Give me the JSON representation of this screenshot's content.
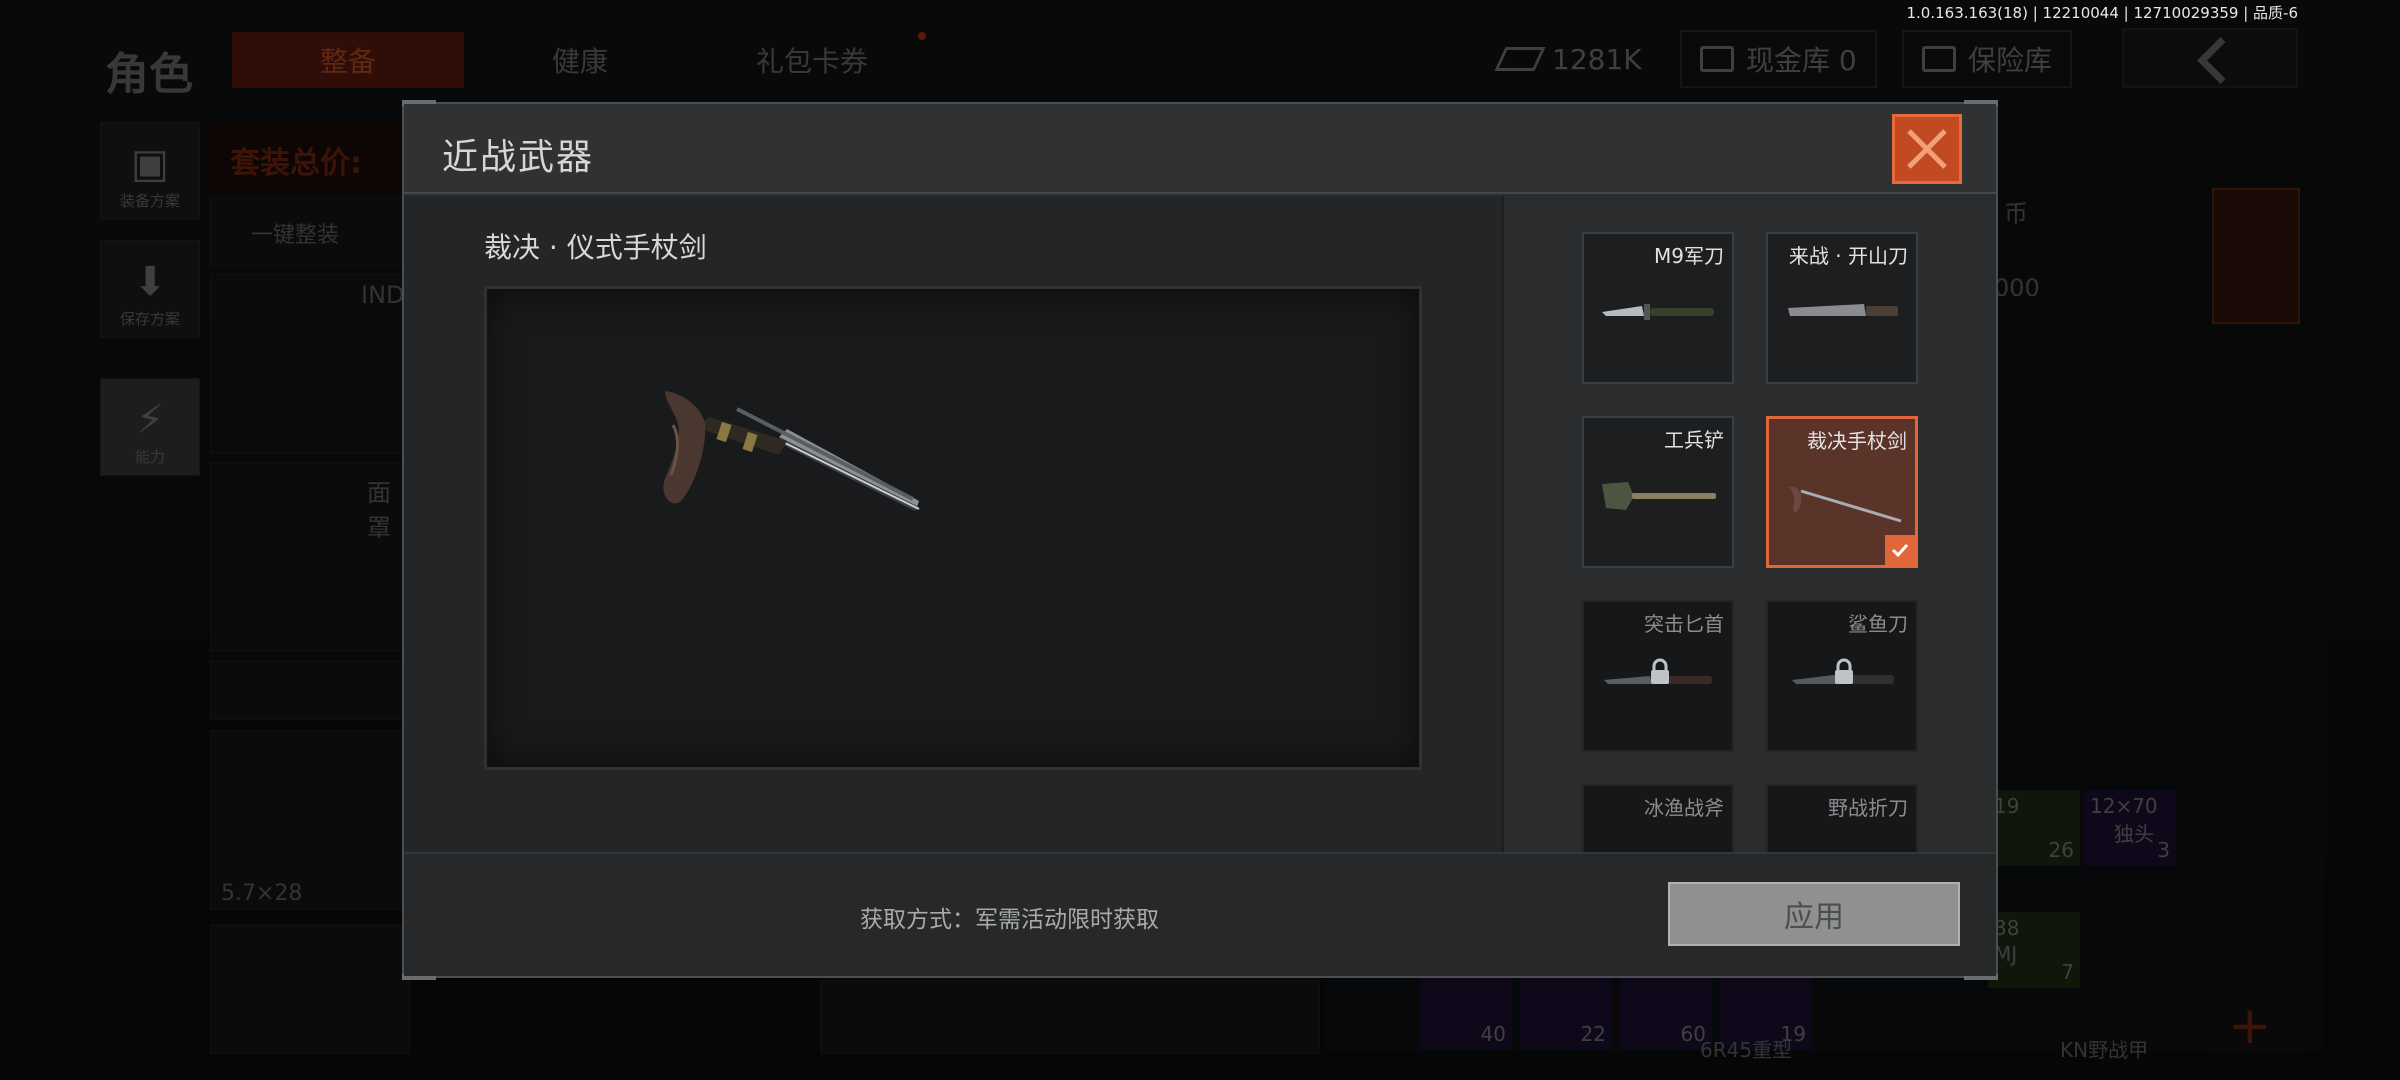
{
  "version_text": "1.0.163.163(18) | 12210044 | 12710029359 | 品质-6",
  "header": {
    "title": "角色",
    "tabs": [
      {
        "label": "整备",
        "active": true
      },
      {
        "label": "健康",
        "active": false
      },
      {
        "label": "礼包卡券",
        "active": false
      }
    ],
    "currency_value": "1281K",
    "cash_vault_label": "现金库 0",
    "insurance_label": "保险库"
  },
  "left_panel": {
    "items": [
      {
        "label": "装备方案",
        "icon": "vest-icon"
      },
      {
        "label": "保存方案",
        "icon": "download-icon"
      },
      {
        "label": "能力",
        "icon": "lightning-icon"
      }
    ]
  },
  "background_labels": {
    "set_price": "套装总价:",
    "quick_equip": "一键整装",
    "ind": "IND",
    "mask": "面罩",
    "caliber": "5.7×28",
    "coin": "币",
    "coin_value": "000",
    "ammo_12x70": "12×70",
    "ammo_slug": "独头",
    "ammo_count_3": "3",
    "ammo_19": "19",
    "ammo_count_26": "26",
    "ammo_38": "38",
    "ammo_mj": "MJ",
    "ammo_count_7": "7",
    "ammo_row": [
      "40",
      "22",
      "60",
      "19"
    ],
    "bottom_6r45": "6R45重型",
    "bottom_kn": "KN野战甲"
  },
  "modal": {
    "title": "近战武器",
    "preview_name": "裁决 · 仪式手杖剑",
    "acquire_text": "获取方式：军需活动限时获取",
    "apply_label": "应用",
    "items": [
      {
        "label": "M9军刀",
        "locked": false,
        "selected": false
      },
      {
        "label": "来战 · 开山刀",
        "locked": false,
        "selected": false
      },
      {
        "label": "工兵铲",
        "locked": false,
        "selected": false
      },
      {
        "label": "裁决手杖剑",
        "locked": false,
        "selected": true
      },
      {
        "label": "突击匕首",
        "locked": true,
        "selected": false
      },
      {
        "label": "鲨鱼刀",
        "locked": true,
        "selected": false
      },
      {
        "label": "冰渔战斧",
        "locked": true,
        "selected": false
      },
      {
        "label": "野战折刀",
        "locked": true,
        "selected": false
      }
    ]
  },
  "colors": {
    "accent": "#e0673a",
    "close_button": "#c24a22",
    "modal_bg": "#2b2d2f"
  }
}
